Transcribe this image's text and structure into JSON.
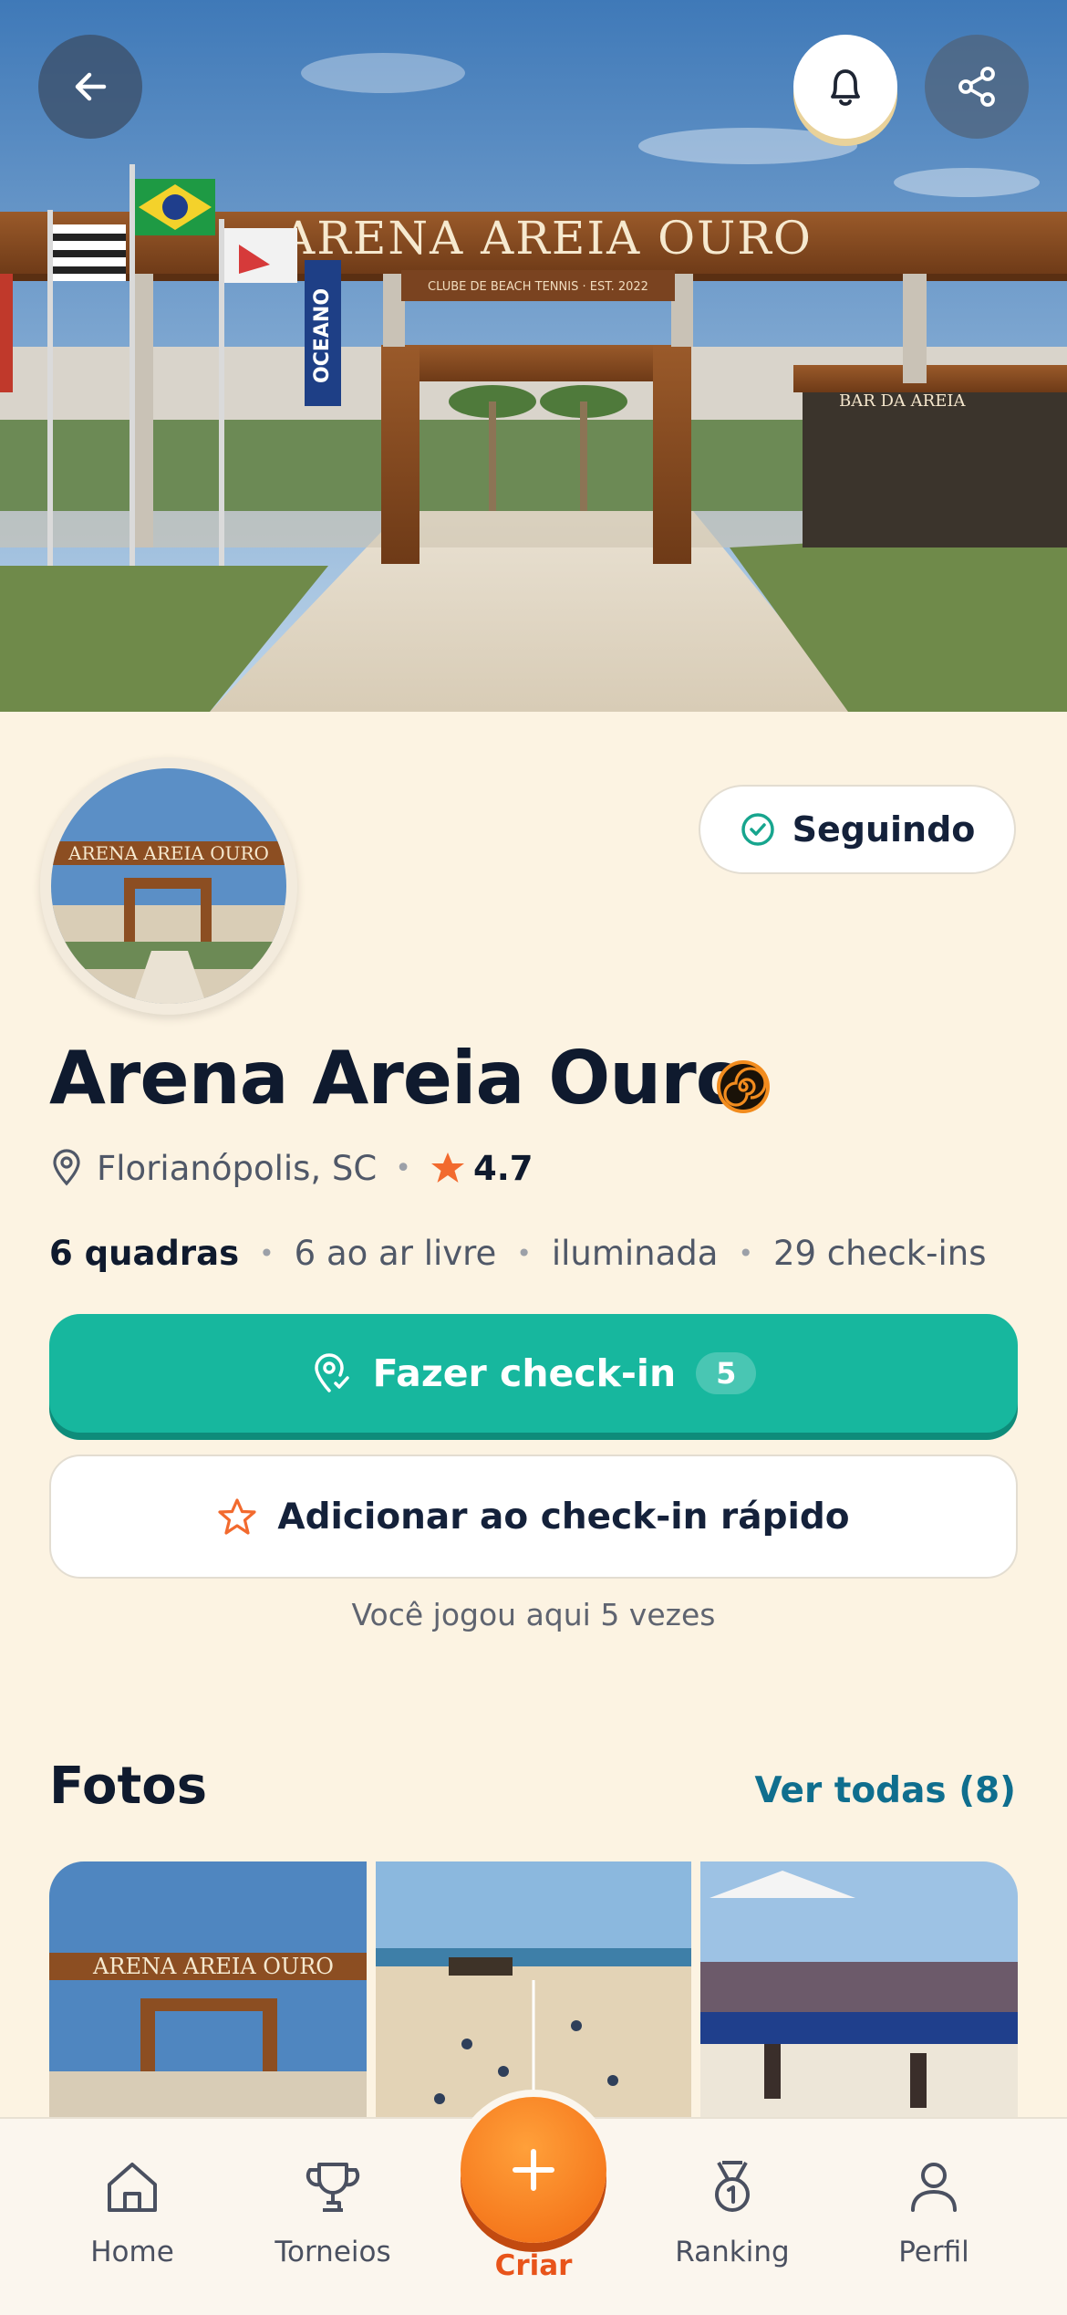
{
  "hero": {
    "sign_text": "ARENA AREIA OURO",
    "sign_subtext": "CLUBE DE BEACH TENNIS · EST. 2022",
    "banner_text": "OCEANO",
    "bar_sign": "BAR DA AREIA"
  },
  "header": {
    "back_icon": "arrow-left-icon",
    "notify_icon": "bell-icon",
    "share_icon": "share-icon"
  },
  "profile": {
    "name": "Arena Areia Ouro",
    "follow_label": "Seguindo",
    "location": "Florianópolis, SC",
    "rating": "4.7",
    "courts": "6 quadras",
    "outdoor": "6 ao ar livre",
    "lighting": "iluminada",
    "checkins": "29 check-ins"
  },
  "actions": {
    "checkin_label": "Fazer check-in",
    "checkin_count": "5",
    "quick_checkin_label": "Adicionar ao check-in rápido",
    "played_note": "Você jogou aqui 5 vezes"
  },
  "photos": {
    "title": "Fotos",
    "see_all": "Ver todas (8)"
  },
  "nav": {
    "home": "Home",
    "tournaments": "Torneios",
    "create": "Criar",
    "ranking": "Ranking",
    "profile": "Perfil"
  },
  "colors": {
    "background": "#FCF3E2",
    "primary_teal": "#17B79E",
    "accent_orange": "#F26A12",
    "link_blue": "#0F6E8E",
    "star": "#F26A2E"
  }
}
